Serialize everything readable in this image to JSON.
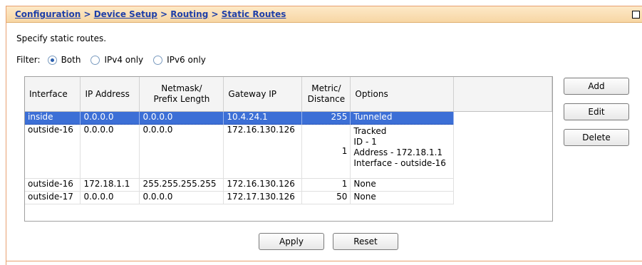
{
  "breadcrumb": {
    "items": [
      "Configuration",
      "Device Setup",
      "Routing",
      "Static Routes"
    ],
    "separator": ">"
  },
  "description": "Specify static routes.",
  "filter": {
    "label": "Filter:",
    "options": [
      "Both",
      "IPv4 only",
      "IPv6 only"
    ],
    "selected": "Both"
  },
  "table": {
    "headers": {
      "interface": "Interface",
      "ip": "IP Address",
      "netmask_l1": "Netmask/",
      "netmask_l2": "Prefix Length",
      "gateway": "Gateway IP",
      "metric_l1": "Metric/",
      "metric_l2": "Distance",
      "options": "Options"
    },
    "rows": [
      {
        "interface": "inside",
        "ip": "0.0.0.0",
        "netmask": "0.0.0.0",
        "gateway": "10.4.24.1",
        "metric": "255",
        "options": [
          "Tunneled"
        ]
      },
      {
        "interface": "outside-16",
        "ip": "0.0.0.0",
        "netmask": "0.0.0.0",
        "gateway": "172.16.130.126",
        "metric": "1",
        "options": [
          "Tracked",
          "ID - 1",
          "Address - 172.18.1.1",
          "Interface - outside-16"
        ]
      },
      {
        "interface": "outside-16",
        "ip": "172.18.1.1",
        "netmask": "255.255.255.255",
        "gateway": "172.16.130.126",
        "metric": "1",
        "options": [
          "None"
        ]
      },
      {
        "interface": "outside-17",
        "ip": "0.0.0.0",
        "netmask": "0.0.0.0",
        "gateway": "172.17.130.126",
        "metric": "50",
        "options": [
          "None"
        ]
      }
    ]
  },
  "buttons": {
    "add": "Add",
    "edit": "Edit",
    "delete": "Delete",
    "apply": "Apply",
    "reset": "Reset"
  },
  "colors": {
    "selection": "#3c6fd6",
    "titlebar": "#f7d6a4",
    "link": "#1f3fa8"
  }
}
